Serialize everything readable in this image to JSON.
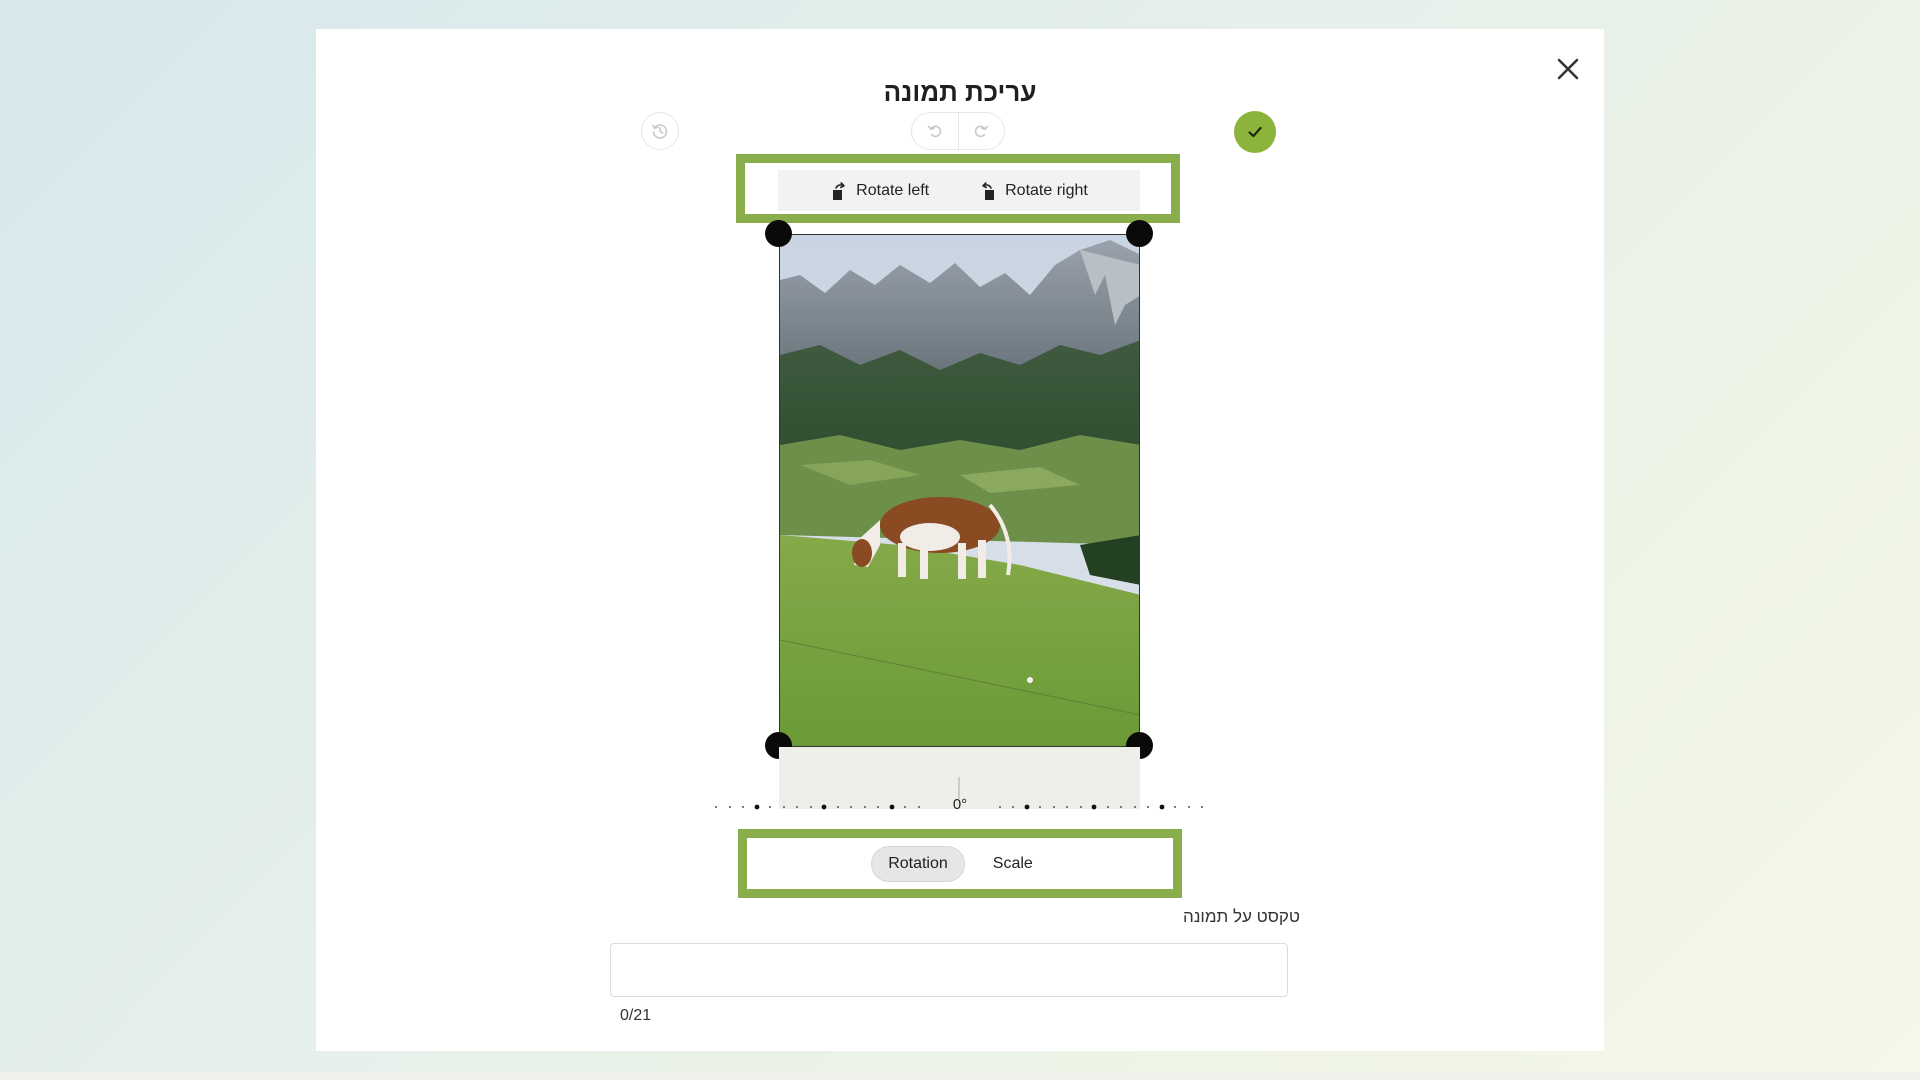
{
  "modal": {
    "title": "עריכת תמונה"
  },
  "toolbar": {
    "reset_icon": "history-reset-icon",
    "undo_icon": "undo-icon",
    "redo_icon": "redo-icon",
    "confirm_icon": "check-icon",
    "close_icon": "close-icon"
  },
  "rotate": {
    "left_label": "Rotate left",
    "right_label": "Rotate right"
  },
  "dial": {
    "angle_label": "0°"
  },
  "modes": {
    "rotation_label": "Rotation",
    "scale_label": "Scale",
    "active": "Rotation"
  },
  "caption": {
    "label": "טקסט על תמונה",
    "value": "",
    "counter": "0/21"
  },
  "colors": {
    "accent": "#8cb43c",
    "highlight": "#8aad4c"
  }
}
